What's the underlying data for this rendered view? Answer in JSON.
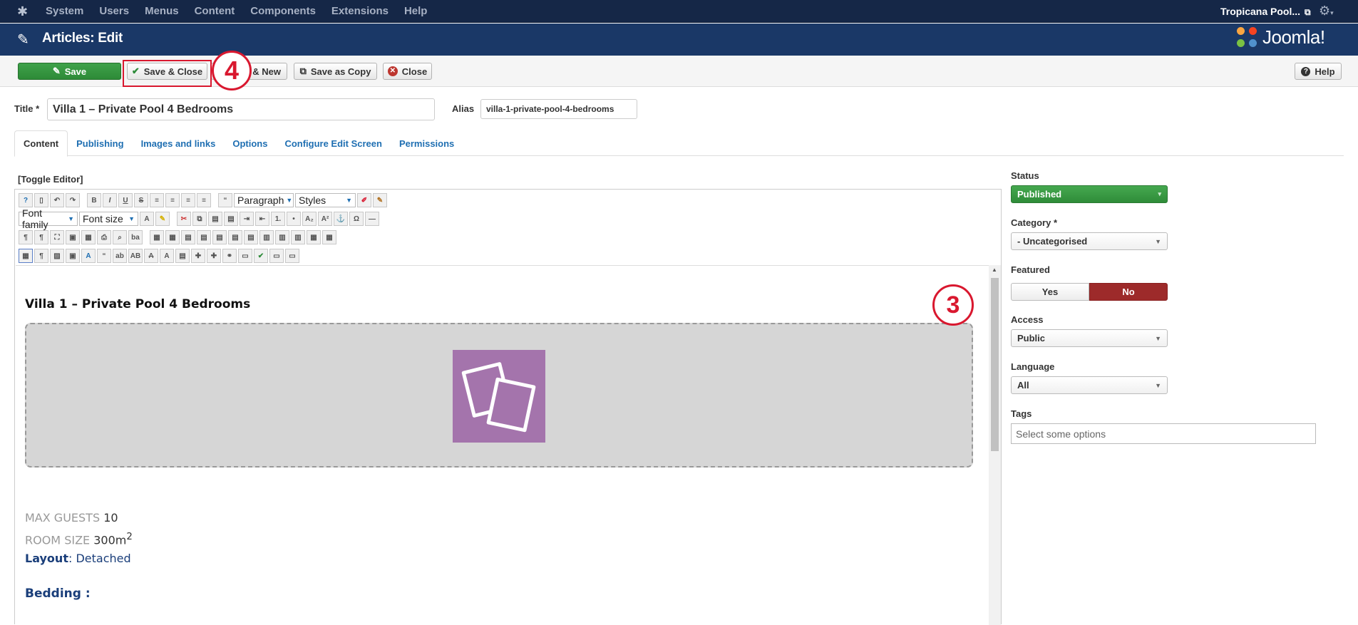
{
  "topbar": {
    "logo_icon": "joomla-icon",
    "menu": [
      "System",
      "Users",
      "Menus",
      "Content",
      "Components",
      "Extensions",
      "Help"
    ],
    "site_name": "Tropicana Pool...",
    "gear": "⚙"
  },
  "header": {
    "title": "Articles: Edit",
    "brand": "Joomla!"
  },
  "toolbar": {
    "save": "Save",
    "save_close": "Save & Close",
    "save_new": "Save & New",
    "save_new_visible": "& New",
    "save_copy": "Save as Copy",
    "close": "Close",
    "help": "Help"
  },
  "steps": {
    "step4": "4",
    "step3": "3"
  },
  "form": {
    "title_label": "Title *",
    "title_value": "Villa 1 – Private Pool 4 Bedrooms",
    "alias_label": "Alias",
    "alias_value": "villa-1-private-pool-4-bedrooms"
  },
  "tabs": [
    "Content",
    "Publishing",
    "Images and links",
    "Options",
    "Configure Edit Screen",
    "Permissions"
  ],
  "editor": {
    "toggle": "[Toggle Editor]",
    "paragraph": "Paragraph",
    "styles": "Styles",
    "font_family": "Font family",
    "font_size": "Font size"
  },
  "content": {
    "heading": "Villa 1 – Private Pool 4 Bedrooms",
    "max_guests_label": "MAX GUESTS",
    "max_guests_value": "10",
    "room_size_label": "ROOM SIZE",
    "room_size_value": "300m",
    "room_size_sup": "2",
    "layout_label": "Layout",
    "layout_value": ": Detached",
    "bedding_label": "Bedding :"
  },
  "sidebar": {
    "status_label": "Status",
    "status_value": "Published",
    "category_label": "Category *",
    "category_value": "- Uncategorised",
    "featured_label": "Featured",
    "featured_yes": "Yes",
    "featured_no": "No",
    "access_label": "Access",
    "access_value": "Public",
    "language_label": "Language",
    "language_value": "All",
    "tags_label": "Tags",
    "tags_placeholder": "Select some options"
  },
  "colors": {
    "topbar": "#152747",
    "header": "#1a3867",
    "save_green": "#2d8a37",
    "featured_no": "#9d2a2a",
    "highlight": "#d9182f",
    "image_placeholder": "#a474ac"
  }
}
